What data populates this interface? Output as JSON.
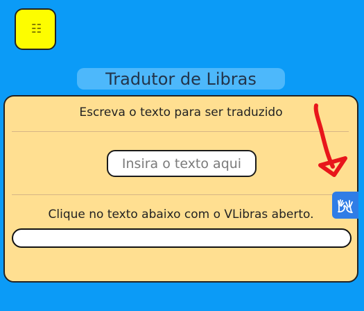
{
  "menu": {
    "icon": "menu-icon",
    "glyph": "☷",
    "color": "#fdfd00"
  },
  "header": {
    "title": "Tradutor de Libras"
  },
  "card": {
    "instruction": "Escreva o texto para ser traduzido",
    "input_placeholder": "Insira o texto aqui",
    "input_value": "",
    "output_instruction": "Clique no texto abaixo com o VLibras aberto.",
    "output_text": "",
    "background": "#ffdf91"
  },
  "annotation": {
    "icon": "red-arrow-annotation",
    "color": "#e8161b"
  },
  "vlibras": {
    "icon": "hands-sign-language-icon",
    "color": "#2f7de6"
  },
  "page": {
    "background": "#0b9bf7"
  }
}
